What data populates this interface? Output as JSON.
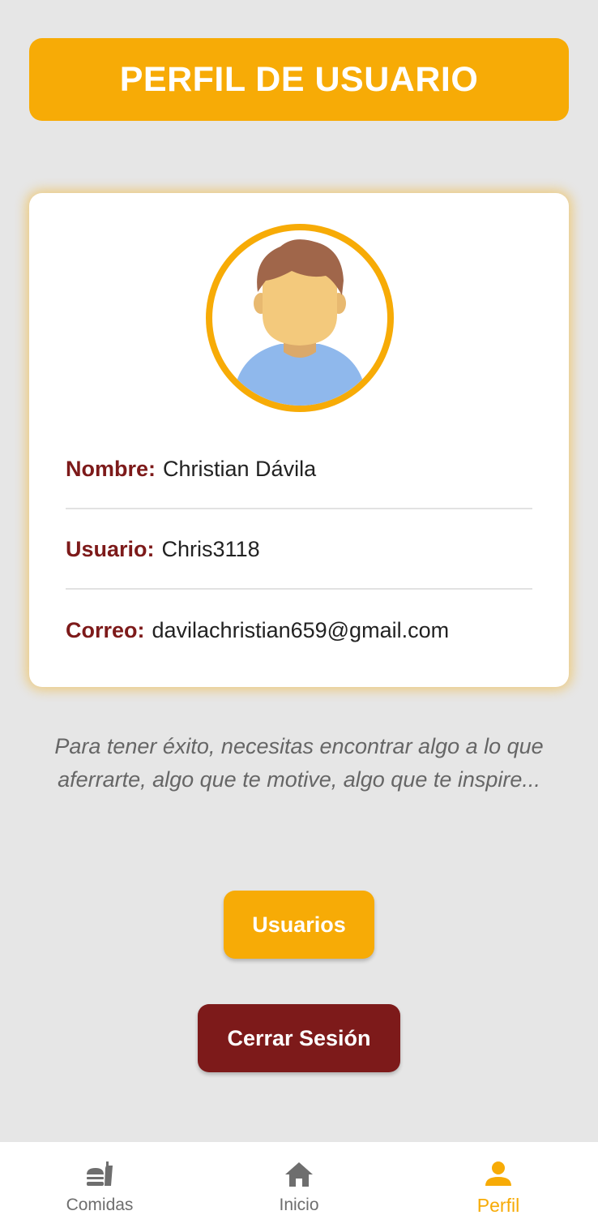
{
  "header": {
    "title": "PERFIL DE USUARIO"
  },
  "profile": {
    "avatar_icon": "user-avatar-illustration",
    "fields": [
      {
        "label": "Nombre:",
        "value": "Christian Dávila"
      },
      {
        "label": "Usuario:",
        "value": "Chris3118"
      },
      {
        "label": "Correo:",
        "value": "davilachristian659@gmail.com"
      }
    ]
  },
  "quote": {
    "text": "Para tener éxito, necesitas encontrar algo a lo que aferrarte, algo que te motive, algo que te inspire..."
  },
  "buttons": {
    "users_label": "Usuarios",
    "logout_label": "Cerrar Sesión"
  },
  "bottom_nav": {
    "items": [
      {
        "label": "Comidas",
        "icon": "fastfood-icon",
        "active": false
      },
      {
        "label": "Inicio",
        "icon": "home-icon",
        "active": false
      },
      {
        "label": "Perfil",
        "icon": "person-icon",
        "active": true
      }
    ]
  },
  "colors": {
    "accent": "#f7ab06",
    "label": "#7d1a1a",
    "logout_button": "#7d1a1a",
    "background": "#e6e6e6",
    "nav_inactive": "#6e6e6e"
  }
}
